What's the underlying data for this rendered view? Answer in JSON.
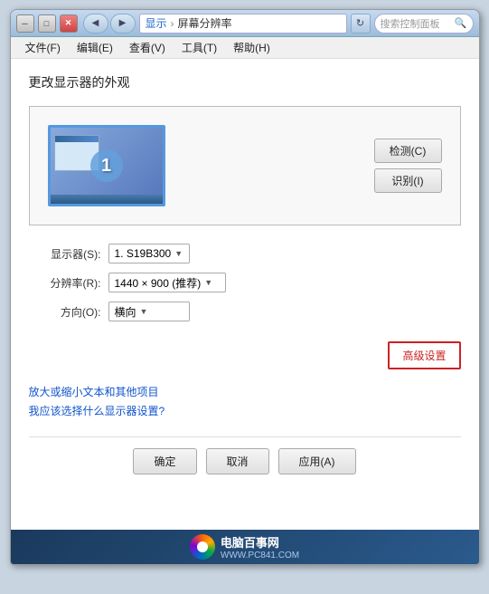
{
  "window": {
    "title": "屏幕分辨率",
    "minimize_label": "─",
    "maximize_label": "□",
    "close_label": "✕"
  },
  "titlebar": {
    "back_arrow": "◀",
    "forward_arrow": "▶",
    "breadcrumb": {
      "display": "显示",
      "sep1": "›",
      "current": "屏幕分辨率"
    },
    "refresh_icon": "↻",
    "search_placeholder": "搜索控制面板",
    "search_icon": "🔍"
  },
  "menu": {
    "items": [
      "文件(F)",
      "编辑(E)",
      "查看(V)",
      "工具(T)",
      "帮助(H)"
    ]
  },
  "page": {
    "title": "更改显示器的外观",
    "monitor_number": "1",
    "detect_btn": "检测(C)",
    "identify_btn": "识别(I)"
  },
  "settings": {
    "display_label": "显示器(S):",
    "display_value": "1. S19B300",
    "resolution_label": "分辨率(R):",
    "resolution_value": "1440 × 900 (推荐)",
    "orientation_label": "方向(O):",
    "orientation_value": "横向",
    "advanced_btn": "高级设置"
  },
  "links": {
    "link1": "放大或缩小文本和其他项目",
    "link2": "我应该选择什么显示器设置?"
  },
  "bottom": {
    "ok_btn": "确定",
    "cancel_btn": "取消",
    "apply_btn": "应用(A)"
  },
  "watermark": {
    "site_name": "电脑百事网",
    "site_url": "WWW.PC841.COM"
  }
}
